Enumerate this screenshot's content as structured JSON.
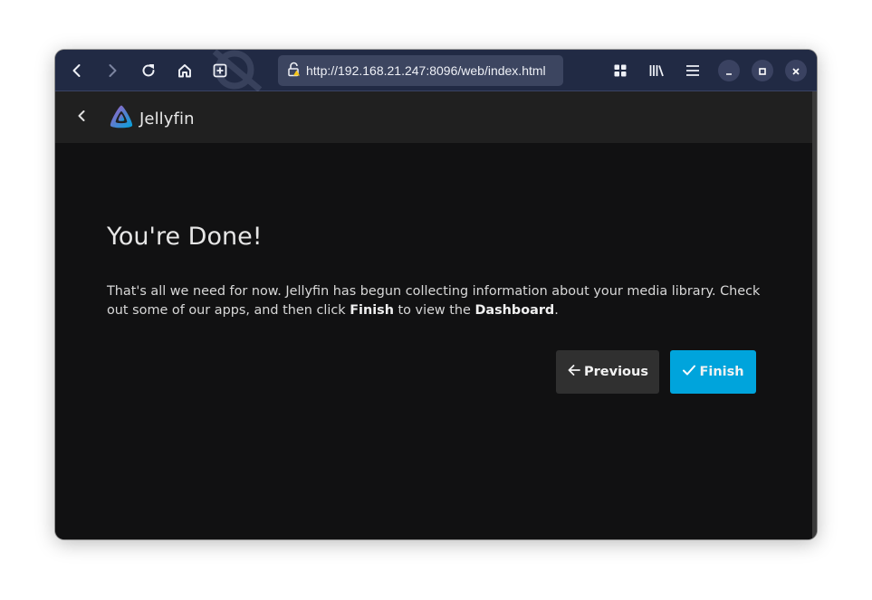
{
  "browser": {
    "url": "http://192.168.21.247:8096/web/index.html",
    "icons": [
      "back-icon",
      "forward-icon",
      "reload-icon",
      "home-icon",
      "new-tab-icon",
      "lock-icon",
      "grid-icon",
      "library-icon",
      "menu-icon",
      "minimize-icon",
      "maximize-icon",
      "close-icon"
    ]
  },
  "app": {
    "name": "Jellyfin"
  },
  "wizard": {
    "title": "You're Done!",
    "desc_part1": "That's all we need for now. Jellyfin has begun collecting information about your media library. Check out some of our apps, and then click ",
    "desc_finish": "Finish",
    "desc_part2": " to view the ",
    "desc_dashboard": "Dashboard",
    "desc_part3": ".",
    "previous_label": "Previous",
    "finish_label": "Finish"
  },
  "colors": {
    "accent": "#00a4dc",
    "toolbar": "#212a44",
    "background": "#111112"
  }
}
